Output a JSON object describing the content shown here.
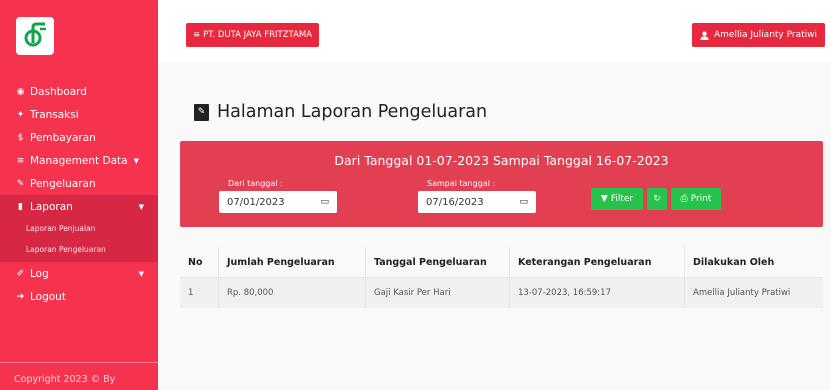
{
  "colors": {
    "sidebar": "#f5334f",
    "accent_red": "#e8283f",
    "success_green": "#27c24c"
  },
  "sidebar": {
    "logo_icon": "company-logo",
    "items": [
      {
        "label": "Dashboard",
        "icon": "dashboard-icon"
      },
      {
        "label": "Transaksi",
        "icon": "handshake-icon"
      },
      {
        "label": "Pembayaran",
        "icon": "dollar-icon"
      },
      {
        "label": "Management Data",
        "icon": "list-icon"
      },
      {
        "label": "Pengeluaran",
        "icon": "edit-icon"
      },
      {
        "label": "Laporan",
        "icon": "book-icon"
      },
      {
        "label": "Log",
        "icon": "log-icon"
      },
      {
        "label": "Logout",
        "icon": "logout-icon"
      }
    ],
    "laporan_sub": [
      "Laporan Penjualan",
      "Laporan Pengeluaran"
    ],
    "copyright": "Copyright 2023 © By"
  },
  "topbar": {
    "company": "PT. DUTA JAYA FRITZTAMA",
    "user": "Amellia Julianty Pratiwi"
  },
  "page": {
    "title": "Halaman Laporan Pengeluaran"
  },
  "filter": {
    "range_text": "Dari Tanggal 01-07-2023 Sampai Tanggal 16-07-2023",
    "from_label": "Dari tanggal :",
    "from_value": "07/01/2023",
    "to_label": "Sampai tanggal :",
    "to_value": "07/16/2023",
    "filter_label": "Filter",
    "print_label": "Print"
  },
  "table": {
    "headers": [
      "No",
      "Jumlah Pengeluaran",
      "Tanggal Pengeluaran",
      "Keterangan Pengeluaran",
      "Dilakukan Oleh"
    ],
    "rows": [
      [
        "1",
        "Rp. 80,000",
        "Gaji Kasir Per Hari",
        "13-07-2023, 16:59:17",
        "Amellia Julianty Pratiwi"
      ]
    ]
  }
}
